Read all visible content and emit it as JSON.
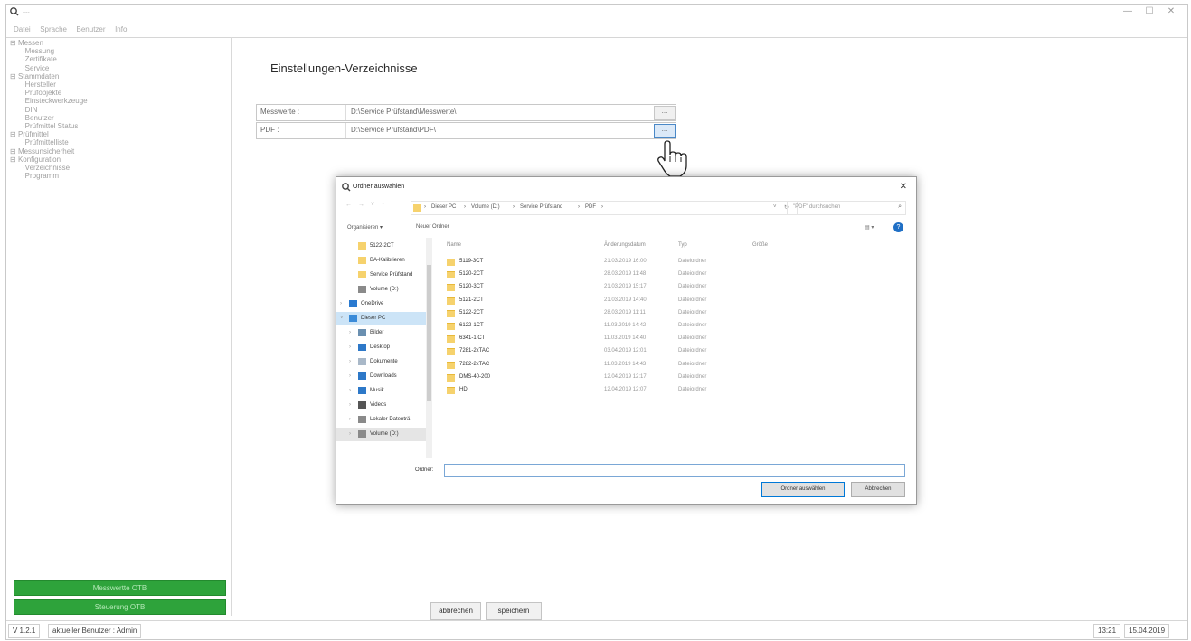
{
  "window": {
    "title": "...."
  },
  "menu": [
    "Datei",
    "Sprache",
    "Benutzer",
    "Info"
  ],
  "tree": [
    {
      "label": "Messen",
      "level": 0
    },
    {
      "label": "Messung",
      "level": 1
    },
    {
      "label": "Zertifikate",
      "level": 1
    },
    {
      "label": "Service",
      "level": 1
    },
    {
      "label": "Stammdaten",
      "level": 0
    },
    {
      "label": "Hersteller",
      "level": 1
    },
    {
      "label": "Prüfobjekte",
      "level": 1
    },
    {
      "label": "Einsteckwerkzeuge",
      "level": 1
    },
    {
      "label": "DIN",
      "level": 1
    },
    {
      "label": "Benutzer",
      "level": 1
    },
    {
      "label": "Prüfmittel Status",
      "level": 1
    },
    {
      "label": "Prüfmittel",
      "level": 0
    },
    {
      "label": "Prüfmittelliste",
      "level": 1
    },
    {
      "label": "Messunsicherheit",
      "level": 0
    },
    {
      "label": "Konfiguration",
      "level": 0
    },
    {
      "label": "Verzeichnisse",
      "level": 1
    },
    {
      "label": "Programm",
      "level": 1
    }
  ],
  "status_buttons": [
    "Messwertte OTB",
    "Steuerung OTB"
  ],
  "settings": {
    "heading": "Einstellungen-Verzeichnisse",
    "rows": [
      {
        "label": "Messwerte :",
        "value": "D:\\Service Prüfstand\\Messwerte\\",
        "button": "..."
      },
      {
        "label": "PDF :",
        "value": "D:\\Service Prüfstand\\PDF\\",
        "button": "..."
      }
    ]
  },
  "actions": {
    "cancel": "abbrechen",
    "save": "speichern"
  },
  "statusbar": {
    "version": "V 1.2.1",
    "user": "aktueller Benutzer : Admin",
    "time": "13:21",
    "date": "15.04.2019"
  },
  "dialog": {
    "title": "Ordner auswählen",
    "close": "✕",
    "breadcrumb": [
      "Dieser PC",
      "Volume (D:)",
      "Service Prüfstand",
      "PDF"
    ],
    "search_placeholder": "\"PDF\" durchsuchen",
    "toolbar": {
      "organize": "Organisieren ▾",
      "new_folder": "Neuer Ordner"
    },
    "nav": [
      {
        "label": "5122-2CT",
        "icon": "folder-icon",
        "indent": 1
      },
      {
        "label": "BA-Kalibrieren",
        "icon": "folder-icon",
        "indent": 1
      },
      {
        "label": "Service Prüfstand",
        "icon": "folder-icon",
        "indent": 1
      },
      {
        "label": "Volume (D:)",
        "icon": "drive-icon",
        "indent": 1
      },
      {
        "label": "OneDrive",
        "icon": "cloud-icon",
        "indent": 0
      },
      {
        "label": "Dieser PC",
        "icon": "pc-icon",
        "indent": 0,
        "selected": true
      },
      {
        "label": "Bilder",
        "icon": "pictures-icon",
        "indent": 1
      },
      {
        "label": "Desktop",
        "icon": "desktop-icon",
        "indent": 1
      },
      {
        "label": "Dokumente",
        "icon": "documents-icon",
        "indent": 1
      },
      {
        "label": "Downloads",
        "icon": "download-icon",
        "indent": 1
      },
      {
        "label": "Musik",
        "icon": "music-icon",
        "indent": 1
      },
      {
        "label": "Videos",
        "icon": "video-icon",
        "indent": 1
      },
      {
        "label": "Lokaler Datenträ",
        "icon": "drive-icon",
        "indent": 1
      },
      {
        "label": "Volume (D:)",
        "icon": "drive-icon",
        "indent": 1,
        "highlighted": true
      }
    ],
    "columns": [
      "Name",
      "Änderungsdatum",
      "Typ",
      "Größe"
    ],
    "files": [
      {
        "name": "5119-3CT",
        "date": "21.03.2019 16:00",
        "type": "Dateiordner"
      },
      {
        "name": "5120-2CT",
        "date": "28.03.2019 11:48",
        "type": "Dateiordner"
      },
      {
        "name": "5120-3CT",
        "date": "21.03.2019 15:17",
        "type": "Dateiordner"
      },
      {
        "name": "5121-2CT",
        "date": "21.03.2019 14:40",
        "type": "Dateiordner"
      },
      {
        "name": "5122-2CT",
        "date": "28.03.2019 11:11",
        "type": "Dateiordner"
      },
      {
        "name": "6122-1CT",
        "date": "11.03.2019 14:42",
        "type": "Dateiordner"
      },
      {
        "name": "6341-1 CT",
        "date": "11.03.2019 14:40",
        "type": "Dateiordner"
      },
      {
        "name": "7281-2xTAC",
        "date": "03.04.2019 12:01",
        "type": "Dateiordner"
      },
      {
        "name": "7282-2xTAC",
        "date": "11.03.2019 14:43",
        "type": "Dateiordner"
      },
      {
        "name": "DMS-40-200",
        "date": "12.04.2019 12:17",
        "type": "Dateiordner"
      },
      {
        "name": "HD",
        "date": "12.04.2019 12:07",
        "type": "Dateiordner"
      }
    ],
    "folder_label": "Ordner:",
    "folder_value": "",
    "ok": "Ordner auswählen",
    "cancel": "Abbrechen"
  },
  "colors": {
    "green": "#2ea33b",
    "accent": "#0078d7",
    "folder": "#f6d26d"
  }
}
